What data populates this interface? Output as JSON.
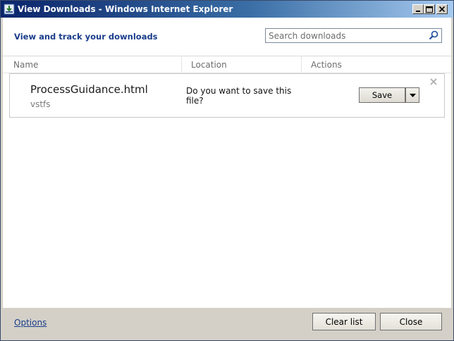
{
  "window": {
    "title": "View Downloads - Windows Internet Explorer",
    "icon": "ie-download-icon"
  },
  "header": {
    "heading": "View and track your downloads",
    "search_placeholder": "Search downloads",
    "search_icon": "search-icon"
  },
  "columns": [
    "Name",
    "Location",
    "Actions"
  ],
  "downloads": [
    {
      "name": "ProcessGuidance.html",
      "source": "vstfs",
      "prompt": "Do you want to save this file?",
      "action_label": "Save"
    }
  ],
  "footer": {
    "options_label": "Options",
    "clear_label": "Clear list",
    "close_label": "Close"
  },
  "colors": {
    "accent": "#1a3d8a",
    "titlebar_start": "#0a246a",
    "titlebar_end": "#a6caf0",
    "chrome": "#d4d0c8"
  }
}
